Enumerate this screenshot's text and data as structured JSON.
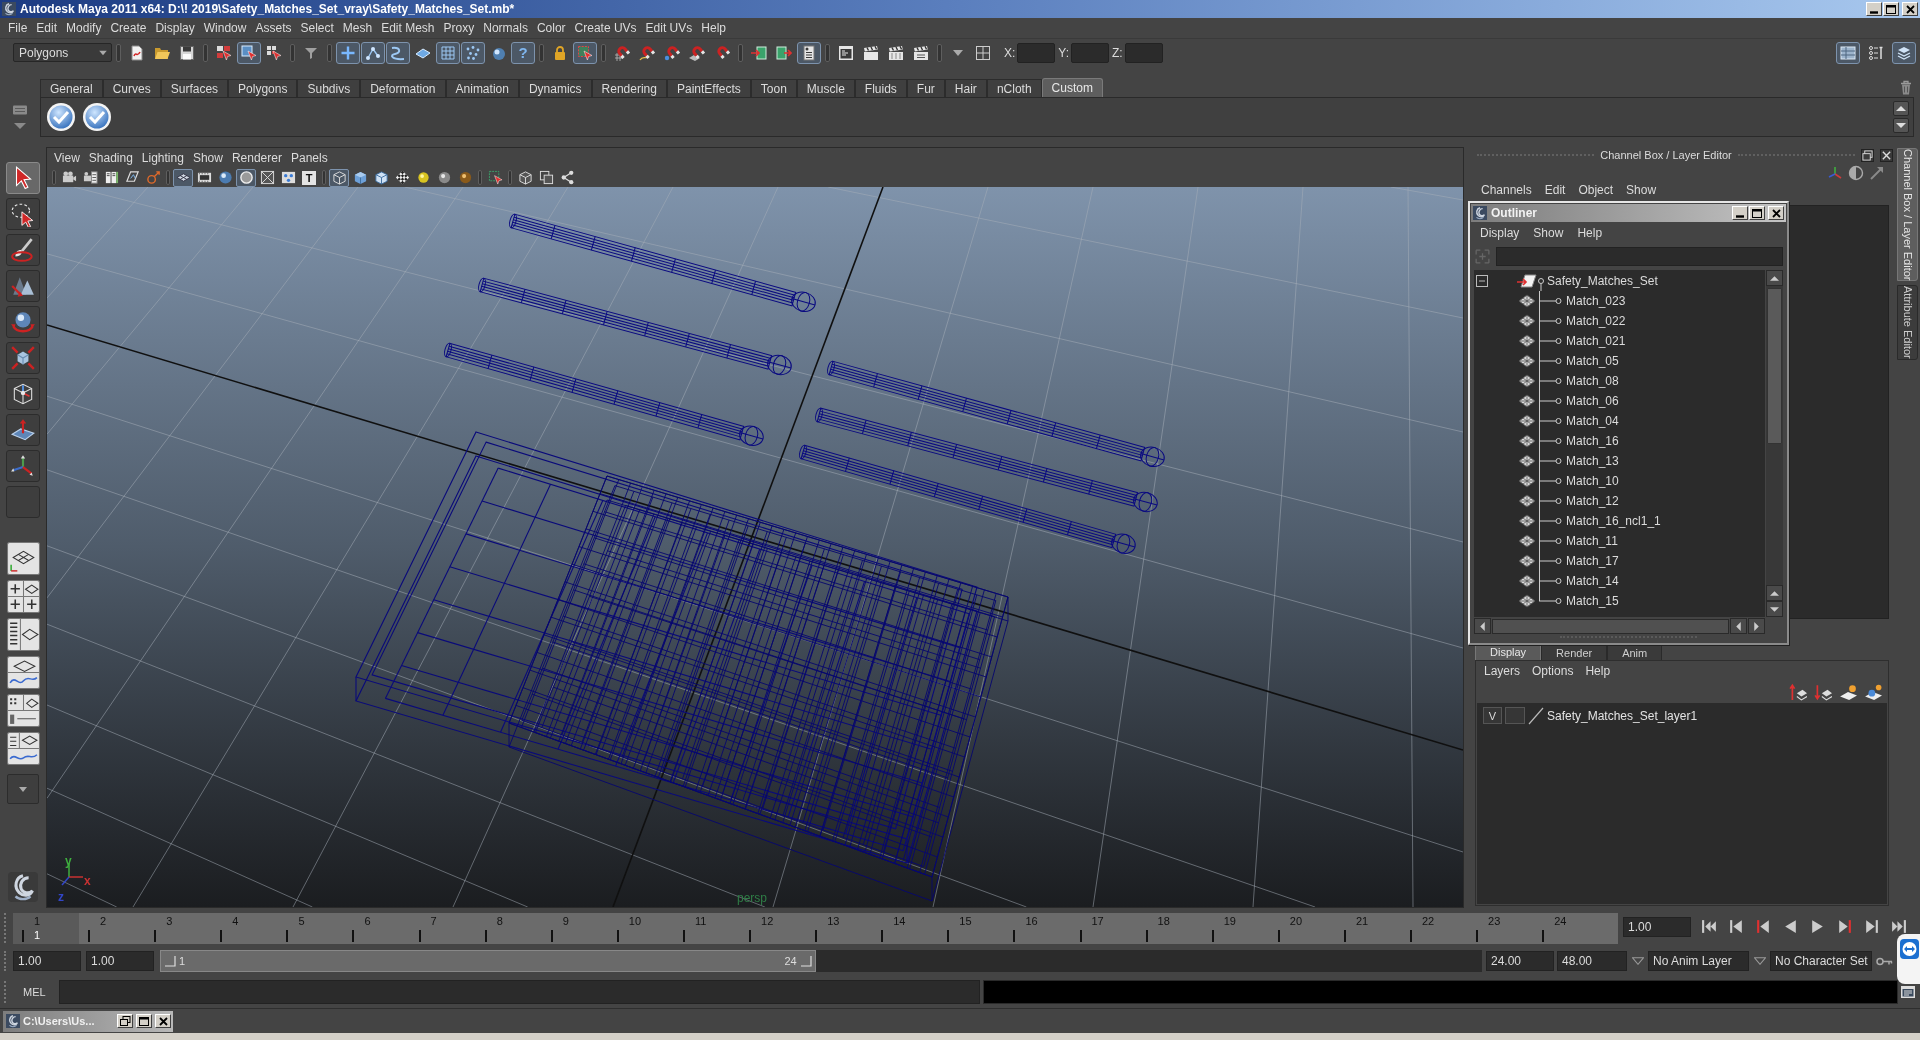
{
  "window": {
    "title": "Autodesk Maya 2011 x64: D:\\! 2019\\Safety_Matches_Set_vray\\Safety_Matches_Set.mb*"
  },
  "menu_bar": [
    "File",
    "Edit",
    "Modify",
    "Create",
    "Display",
    "Window",
    "Assets",
    "Select",
    "Mesh",
    "Edit Mesh",
    "Proxy",
    "Normals",
    "Color",
    "Create UVs",
    "Edit UVs",
    "Help"
  ],
  "status_line": {
    "menu_set": "Polygons",
    "tool_groups": [
      [
        {
          "kind": "new-scene",
          "pressed": false
        },
        {
          "kind": "open-scene",
          "pressed": false
        },
        {
          "kind": "save-scene",
          "pressed": false
        }
      ],
      [
        {
          "kind": "select-hierarchy",
          "pressed": false
        },
        {
          "kind": "select-object",
          "pressed": true
        },
        {
          "kind": "select-component",
          "pressed": false
        }
      ],
      [
        {
          "kind": "mask-filter",
          "pressed": false
        }
      ],
      [
        {
          "kind": "mask-handles",
          "pressed": true
        },
        {
          "kind": "mask-joints",
          "pressed": true
        },
        {
          "kind": "mask-curves",
          "pressed": true
        },
        {
          "kind": "mask-surfaces",
          "pressed": false
        },
        {
          "kind": "mask-deformers",
          "pressed": true
        },
        {
          "kind": "mask-dynamics",
          "pressed": true
        },
        {
          "kind": "mask-rendering",
          "pressed": false
        },
        {
          "kind": "mask-misc",
          "pressed": true,
          "glyph": "?"
        }
      ],
      [
        {
          "kind": "lock-selection",
          "pressed": false
        },
        {
          "kind": "highlight-selection",
          "pressed": true
        }
      ],
      [
        {
          "kind": "snap-grid",
          "pressed": false
        },
        {
          "kind": "snap-curve",
          "pressed": false
        },
        {
          "kind": "snap-point",
          "pressed": false
        },
        {
          "kind": "snap-plane",
          "pressed": false
        },
        {
          "kind": "snap-live",
          "pressed": false
        }
      ],
      [
        {
          "kind": "input-ops",
          "pressed": false
        },
        {
          "kind": "output-ops",
          "pressed": false
        },
        {
          "kind": "history",
          "pressed": true
        }
      ],
      [
        {
          "kind": "render-view",
          "pressed": false
        },
        {
          "kind": "render-frame",
          "pressed": false
        },
        {
          "kind": "ipr-render",
          "pressed": false
        },
        {
          "kind": "render-settings",
          "pressed": false
        }
      ],
      [
        {
          "kind": "input-mode",
          "pressed": false
        },
        {
          "kind": "absolute-transform",
          "pressed": false
        }
      ]
    ],
    "coordinate_fields": [
      "X:",
      "Y:",
      "Z:"
    ],
    "panel_toggles": [
      {
        "kind": "attribute-editor",
        "pressed": true
      },
      {
        "kind": "tool-settings",
        "pressed": false
      },
      {
        "kind": "channel-box",
        "pressed": true
      }
    ]
  },
  "shelf": {
    "tabs": [
      {
        "label": "General",
        "selected": false
      },
      {
        "label": "Curves",
        "selected": false
      },
      {
        "label": "Surfaces",
        "selected": false
      },
      {
        "label": "Polygons",
        "selected": false
      },
      {
        "label": "Subdivs",
        "selected": false
      },
      {
        "label": "Deformation",
        "selected": false
      },
      {
        "label": "Animation",
        "selected": false
      },
      {
        "label": "Dynamics",
        "selected": false
      },
      {
        "label": "Rendering",
        "selected": false
      },
      {
        "label": "PaintEffects",
        "selected": false
      },
      {
        "label": "Toon",
        "selected": false
      },
      {
        "label": "Muscle",
        "selected": false
      },
      {
        "label": "Fluids",
        "selected": false
      },
      {
        "label": "Fur",
        "selected": false
      },
      {
        "label": "Hair",
        "selected": false
      },
      {
        "label": "nCloth",
        "selected": false
      },
      {
        "label": "Custom",
        "selected": true
      }
    ],
    "buttons": [
      {
        "kind": "check"
      },
      {
        "kind": "check"
      }
    ]
  },
  "toolbox": {
    "tools": [
      {
        "kind": "select",
        "selected": true
      },
      {
        "kind": "lasso",
        "selected": false
      },
      {
        "kind": "paint-select",
        "selected": false
      },
      {
        "kind": "move",
        "selected": false
      },
      {
        "kind": "rotate",
        "selected": false
      },
      {
        "kind": "scale",
        "selected": false
      },
      {
        "kind": "universal",
        "selected": false
      },
      {
        "kind": "soft-mod",
        "selected": false
      },
      {
        "kind": "show-manip",
        "selected": false
      },
      {
        "kind": "last-tool",
        "selected": false
      }
    ]
  },
  "viewport": {
    "menu": [
      "View",
      "Shading",
      "Lighting",
      "Show",
      "Renderer",
      "Panels"
    ],
    "tool_groups": [
      [
        {
          "kind": "select-camera",
          "pressed": false
        },
        {
          "kind": "camera-attributes",
          "pressed": false
        },
        {
          "kind": "bookmark",
          "pressed": false
        },
        {
          "kind": "image-plane",
          "pressed": false
        },
        {
          "kind": "two-d-pan",
          "pressed": false
        }
      ],
      [
        {
          "kind": "grid",
          "pressed": true
        },
        {
          "kind": "film-gate",
          "pressed": false
        },
        {
          "kind": "resolution-gate",
          "pressed": false
        },
        {
          "kind": "gate-mask",
          "pressed": true
        },
        {
          "kind": "field-chart",
          "pressed": false
        },
        {
          "kind": "safe-action",
          "pressed": false
        },
        {
          "kind": "hud",
          "pressed": false,
          "glyph": "T"
        }
      ],
      [
        {
          "kind": "wireframe",
          "pressed": true
        },
        {
          "kind": "smooth-shade",
          "pressed": false
        },
        {
          "kind": "wire-on-shaded",
          "pressed": false
        },
        {
          "kind": "textured",
          "pressed": false
        },
        {
          "kind": "default-light",
          "pressed": false
        },
        {
          "kind": "all-lights",
          "pressed": false
        },
        {
          "kind": "shadows",
          "pressed": false
        }
      ],
      [
        {
          "kind": "isolate",
          "pressed": false
        }
      ],
      [
        {
          "kind": "xray",
          "pressed": false
        },
        {
          "kind": "xray-joints",
          "pressed": false
        },
        {
          "kind": "xray-components",
          "pressed": false
        }
      ]
    ],
    "axis_labels": [
      {
        "text": "y",
        "color": "#3fae3f"
      },
      {
        "text": "x",
        "color": "#c83232"
      },
      {
        "text": "z",
        "color": "#3246c8"
      }
    ],
    "camera_label": "persp"
  },
  "channel_box": {
    "title": "Channel Box / Layer Editor",
    "menu": [
      "Channels",
      "Edit",
      "Object",
      "Show"
    ]
  },
  "outliner": {
    "title": "Outliner",
    "menu": [
      "Display",
      "Show",
      "Help"
    ],
    "items": [
      {
        "name": "Safety_Matches_Set",
        "kind": "transform",
        "expanded": true,
        "selected": false,
        "children": [
          {
            "name": "Match_023",
            "kind": "mesh",
            "selected": false
          },
          {
            "name": "Match_022",
            "kind": "mesh",
            "selected": false
          },
          {
            "name": "Match_021",
            "kind": "mesh",
            "selected": false
          },
          {
            "name": "Match_05",
            "kind": "mesh",
            "selected": false
          },
          {
            "name": "Match_08",
            "kind": "mesh",
            "selected": false
          },
          {
            "name": "Match_06",
            "kind": "mesh",
            "selected": false
          },
          {
            "name": "Match_04",
            "kind": "mesh",
            "selected": false
          },
          {
            "name": "Match_16",
            "kind": "mesh",
            "selected": false
          },
          {
            "name": "Match_13",
            "kind": "mesh",
            "selected": false
          },
          {
            "name": "Match_10",
            "kind": "mesh",
            "selected": false
          },
          {
            "name": "Match_12",
            "kind": "mesh",
            "selected": false
          },
          {
            "name": "Match_16_ncl1_1",
            "kind": "mesh",
            "selected": false
          },
          {
            "name": "Match_11",
            "kind": "mesh",
            "selected": false
          },
          {
            "name": "Match_17",
            "kind": "mesh",
            "selected": false
          },
          {
            "name": "Match_14",
            "kind": "mesh",
            "selected": false
          },
          {
            "name": "Match_15",
            "kind": "mesh",
            "selected": false
          }
        ]
      }
    ]
  },
  "layer_editor": {
    "tabs": [
      {
        "label": "Display",
        "selected": true
      },
      {
        "label": "Render",
        "selected": false
      },
      {
        "label": "Anim",
        "selected": false
      }
    ],
    "menu": [
      "Layers",
      "Options",
      "Help"
    ],
    "layers": [
      {
        "name": "Safety_Matches_Set_layer1",
        "visible": true,
        "visibility_label": "V"
      }
    ]
  },
  "side_tabs": [
    {
      "label": "Channel Box / Layer Editor",
      "selected": true
    },
    {
      "label": "Attribute Editor",
      "selected": false
    }
  ],
  "time_slider": {
    "frames": [
      {
        "label": "1",
        "selected": true
      },
      {
        "label": "2",
        "selected": false
      },
      {
        "label": "3",
        "selected": false
      },
      {
        "label": "4",
        "selected": false
      },
      {
        "label": "5",
        "selected": false
      },
      {
        "label": "6",
        "selected": false
      },
      {
        "label": "7",
        "selected": false
      },
      {
        "label": "8",
        "selected": false
      },
      {
        "label": "9",
        "selected": false
      },
      {
        "label": "10",
        "selected": false
      },
      {
        "label": "11",
        "selected": false
      },
      {
        "label": "12",
        "selected": false
      },
      {
        "label": "13",
        "selected": false
      },
      {
        "label": "14",
        "selected": false
      },
      {
        "label": "15",
        "selected": false
      },
      {
        "label": "16",
        "selected": false
      },
      {
        "label": "17",
        "selected": false
      },
      {
        "label": "18",
        "selected": false
      },
      {
        "label": "19",
        "selected": false
      },
      {
        "label": "20",
        "selected": false
      },
      {
        "label": "21",
        "selected": false
      },
      {
        "label": "22",
        "selected": false
      },
      {
        "label": "23",
        "selected": false
      },
      {
        "label": "24",
        "selected": false
      }
    ],
    "current_frame": "1",
    "current_time": "1.00"
  },
  "range_slider": {
    "start_time": "1.00",
    "playback_start": "1.00",
    "range_start": "1",
    "range_end": "24",
    "level": 0.496,
    "playback_end": "24.00",
    "end_time": "48.00",
    "anim_layer": "No Anim Layer",
    "character_set": "No Character Set"
  },
  "command_line": {
    "language": "MEL"
  },
  "taskbar": {
    "minimized_window": "C:\\Users\\Us..."
  }
}
